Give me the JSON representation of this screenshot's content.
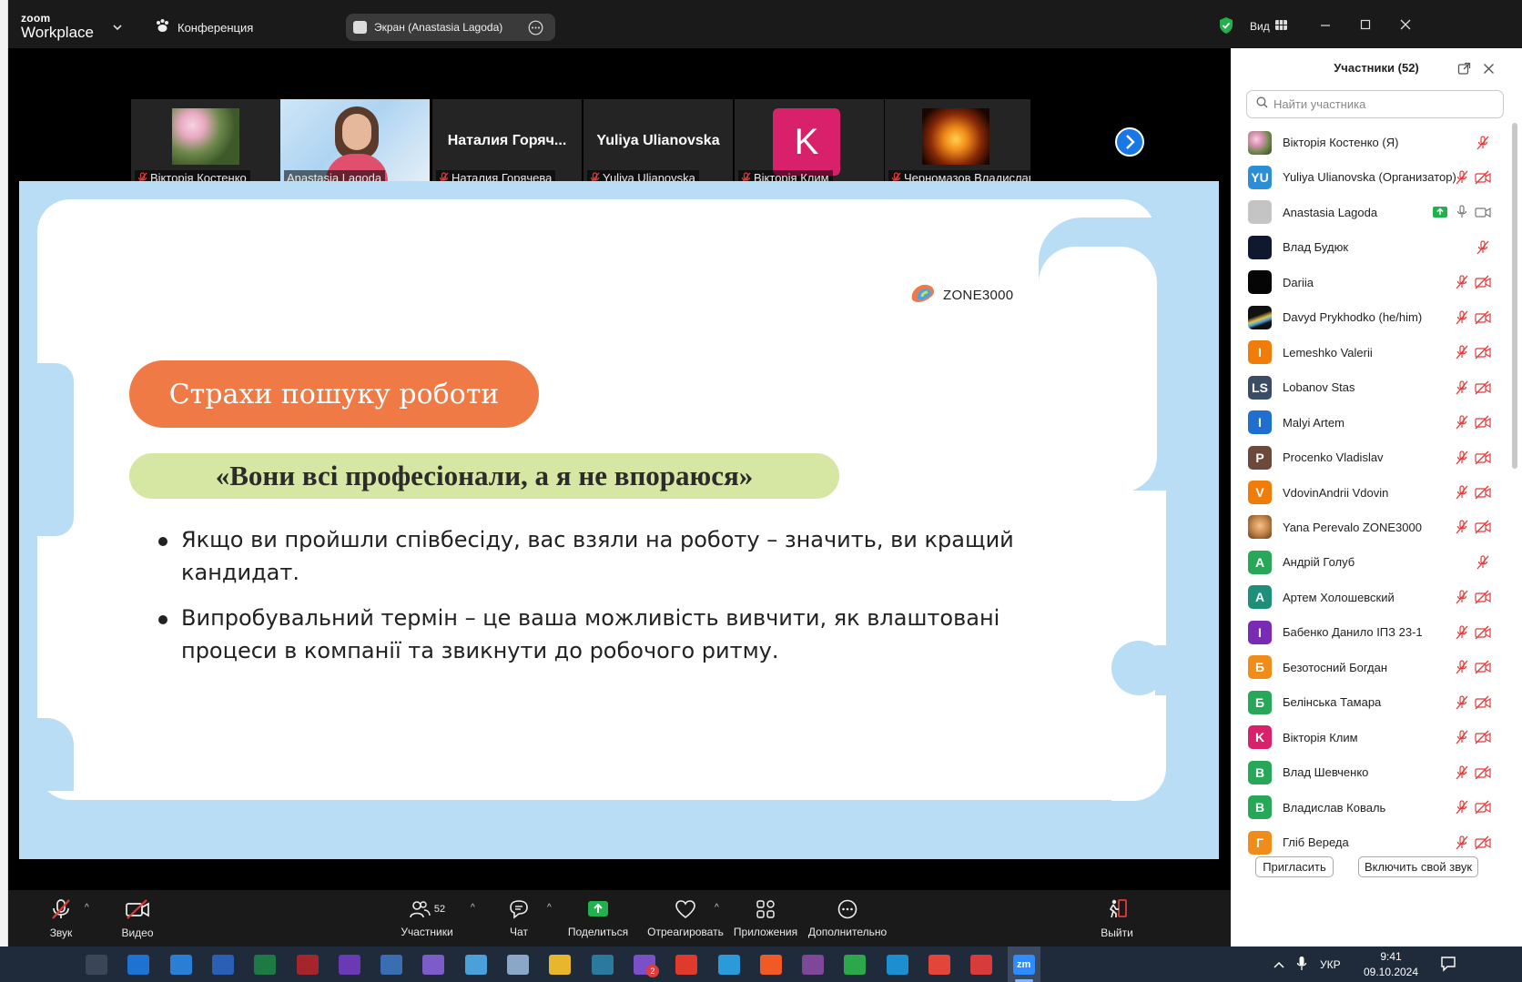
{
  "app": {
    "logo_small": "zoom",
    "logo_big": "Workplace",
    "conference_label": "Конференция",
    "share_label": "Экран (Anastasia Lagoda)",
    "view_label": "Вид"
  },
  "filmstrip": [
    {
      "name": "Вікторія Костенко",
      "kind": "photo-flowers",
      "muted": true
    },
    {
      "name": "Anastasia Lagoda",
      "kind": "video",
      "active": true,
      "muted": false
    },
    {
      "name": "Наталия Горячева",
      "big": "Наталия Горяч...",
      "kind": "text",
      "muted": true
    },
    {
      "name": "Yuliya Ulianovska",
      "big": "Yuliya Ulianovska",
      "kind": "text",
      "muted": true
    },
    {
      "name": "Вікторія Клим",
      "kind": "letter",
      "letter": "K",
      "color": "#d8206b",
      "muted": true
    },
    {
      "name": "Черномазов Владислав",
      "kind": "photo-fire",
      "muted": true
    }
  ],
  "slide": {
    "brand": "ZONE3000",
    "title": "Страхи пошуку роботи",
    "quote": "«Вони всі професіонали, а я не впораюся»",
    "bullets": [
      "Якщо ви пройшли співбесіду, вас взяли на роботу – значить, ви кращий кандидат.",
      "Випробувальний термін – це ваша можливість вивчити, як влаштовані процеси в компанії та звикнути до робочого ритму."
    ]
  },
  "toolbar": {
    "audio": "Звук",
    "video": "Видео",
    "participants": "Участники",
    "participants_count": "52",
    "chat": "Чат",
    "share": "Поделиться",
    "react": "Отреагировать",
    "apps": "Приложения",
    "more": "Дополнительно",
    "leave": "Выйти"
  },
  "panel": {
    "title": "Участники (52)",
    "search_placeholder": "Найти участника",
    "invite": "Пригласить",
    "unmute": "Включить свой звук",
    "participants": [
      {
        "name": "Вікторія Костенко (Я)",
        "avatar": "img-flowers",
        "color": "#c98fa7",
        "icons": "mic"
      },
      {
        "name": "Yuliya Ulianovska (Организатор)",
        "avatar": "YU",
        "color": "#2c8fd6",
        "icons": "mic-cam"
      },
      {
        "name": "Anastasia Lagoda",
        "avatar": "img-grey",
        "color": "#c4c4c4",
        "icons": "share-mic-cam"
      },
      {
        "name": "Влад Будюк",
        "avatar": "img-dark",
        "color": "#101830",
        "icons": "mic"
      },
      {
        "name": "Dariia",
        "avatar": "img-black",
        "color": "#050505",
        "icons": "mic-cam"
      },
      {
        "name": "Davyd Prykhodko (he/him)",
        "avatar": "img-prism",
        "color": "#111111",
        "icons": "mic-cam"
      },
      {
        "name": "Lemeshko Valerii",
        "avatar": "I",
        "color": "#f07d0a",
        "icons": "mic-cam"
      },
      {
        "name": "Lobanov Stas",
        "avatar": "LS",
        "color": "#3b4c66",
        "icons": "mic-cam"
      },
      {
        "name": "Malyi Artem",
        "avatar": "I",
        "color": "#1f6fd1",
        "icons": "mic-cam"
      },
      {
        "name": "Procenko Vladislav",
        "avatar": "P",
        "color": "#6b4a3b",
        "icons": "mic-cam"
      },
      {
        "name": "VdovinAndrii Vdovin",
        "avatar": "V",
        "color": "#f07d0a",
        "icons": "mic-cam"
      },
      {
        "name": "Yana Perevalo ZONE3000",
        "avatar": "img-cat",
        "color": "#c98a4d",
        "icons": "mic-cam"
      },
      {
        "name": "Андрій Голуб",
        "avatar": "A",
        "color": "#27a859",
        "icons": "mic"
      },
      {
        "name": "Артем Холошевский",
        "avatar": "A",
        "color": "#1f8f7a",
        "icons": "mic-cam"
      },
      {
        "name": "Бабенко Данило ІПЗ 23-1",
        "avatar": "I",
        "color": "#7b2bb3",
        "icons": "mic-cam"
      },
      {
        "name": "Безотосний Богдан",
        "avatar": "Б",
        "color": "#f08d1a",
        "icons": "mic-cam"
      },
      {
        "name": "Белінська Тамара",
        "avatar": "Б",
        "color": "#27a859",
        "icons": "mic-cam"
      },
      {
        "name": "Вікторія Клим",
        "avatar": "K",
        "color": "#d8206b",
        "icons": "mic-cam"
      },
      {
        "name": "Влад Шевченко",
        "avatar": "B",
        "color": "#27a859",
        "icons": "mic-cam"
      },
      {
        "name": "Владислав Коваль",
        "avatar": "B",
        "color": "#27a859",
        "icons": "mic-cam"
      },
      {
        "name": "Гліб Вереда",
        "avatar": "Г",
        "color": "#f08d1a",
        "icons": "mic-cam"
      }
    ]
  },
  "taskbar": {
    "lang": "УКР",
    "time": "9:41",
    "date": "09.10.2024",
    "apps": [
      {
        "name": "task-view",
        "color": "#3a4558"
      },
      {
        "name": "mail",
        "color": "#1e73d2"
      },
      {
        "name": "store",
        "color": "#2a7fd4"
      },
      {
        "name": "word",
        "color": "#2b5fb5"
      },
      {
        "name": "excel",
        "color": "#1e7a44"
      },
      {
        "name": "access",
        "color": "#a4262c"
      },
      {
        "name": "visual-studio",
        "color": "#6a3ab5"
      },
      {
        "name": "network-tool",
        "color": "#3b6db3"
      },
      {
        "name": "quill",
        "color": "#7b5cc9"
      },
      {
        "name": "paint",
        "color": "#4aa0d8"
      },
      {
        "name": "file-tool",
        "color": "#8aa7c8"
      },
      {
        "name": "file-explorer",
        "color": "#e8b62c"
      },
      {
        "name": "globe-app",
        "color": "#2b7a9e"
      },
      {
        "name": "viber",
        "color": "#7a50c8",
        "badge": "2"
      },
      {
        "name": "wps-office",
        "color": "#e03a2c"
      },
      {
        "name": "telegram",
        "color": "#2a9ad8"
      },
      {
        "name": "brave",
        "color": "#f05a24"
      },
      {
        "name": "tor",
        "color": "#7e4798"
      },
      {
        "name": "green-browser",
        "color": "#2aa84a"
      },
      {
        "name": "edge",
        "color": "#1d8fd1"
      },
      {
        "name": "chrome",
        "color": "#e4453a"
      },
      {
        "name": "red-app",
        "color": "#d83b3b"
      },
      {
        "name": "zoom",
        "color": "#2d8cff",
        "label": "zm",
        "active": true
      }
    ]
  }
}
